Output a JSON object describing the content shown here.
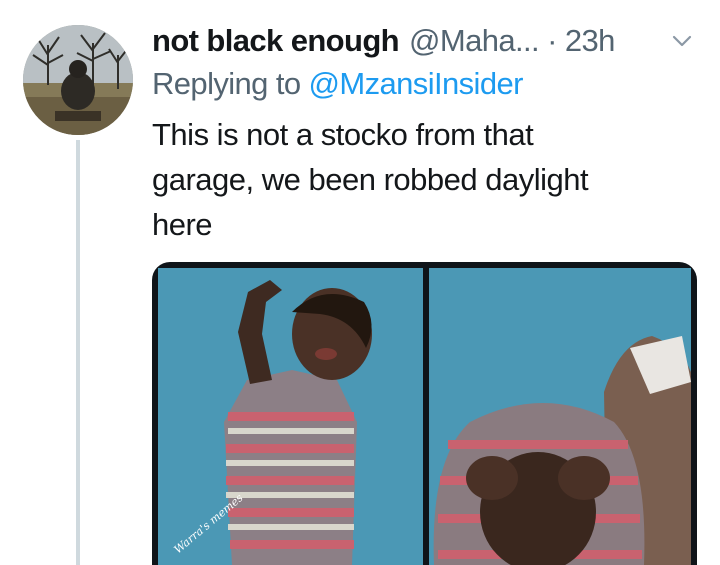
{
  "tweet": {
    "display_name": "not black enough",
    "handle": "@Maha...",
    "separator": "·",
    "time": "23h",
    "reply_prefix": "Replying to",
    "reply_to": "@MzansiInsider",
    "text_lines": [
      "This is not a stocko from that",
      "garage, we been robbed daylight",
      "here"
    ]
  },
  "media": {
    "watermark": "Warra's memes"
  },
  "icons": {
    "menu": "chevron-down-icon"
  },
  "colors": {
    "text": "#14171a",
    "secondary": "#536471",
    "link": "#1d9bf0",
    "thread_line": "#cfd9de",
    "photo_background": "#4b98b5"
  }
}
